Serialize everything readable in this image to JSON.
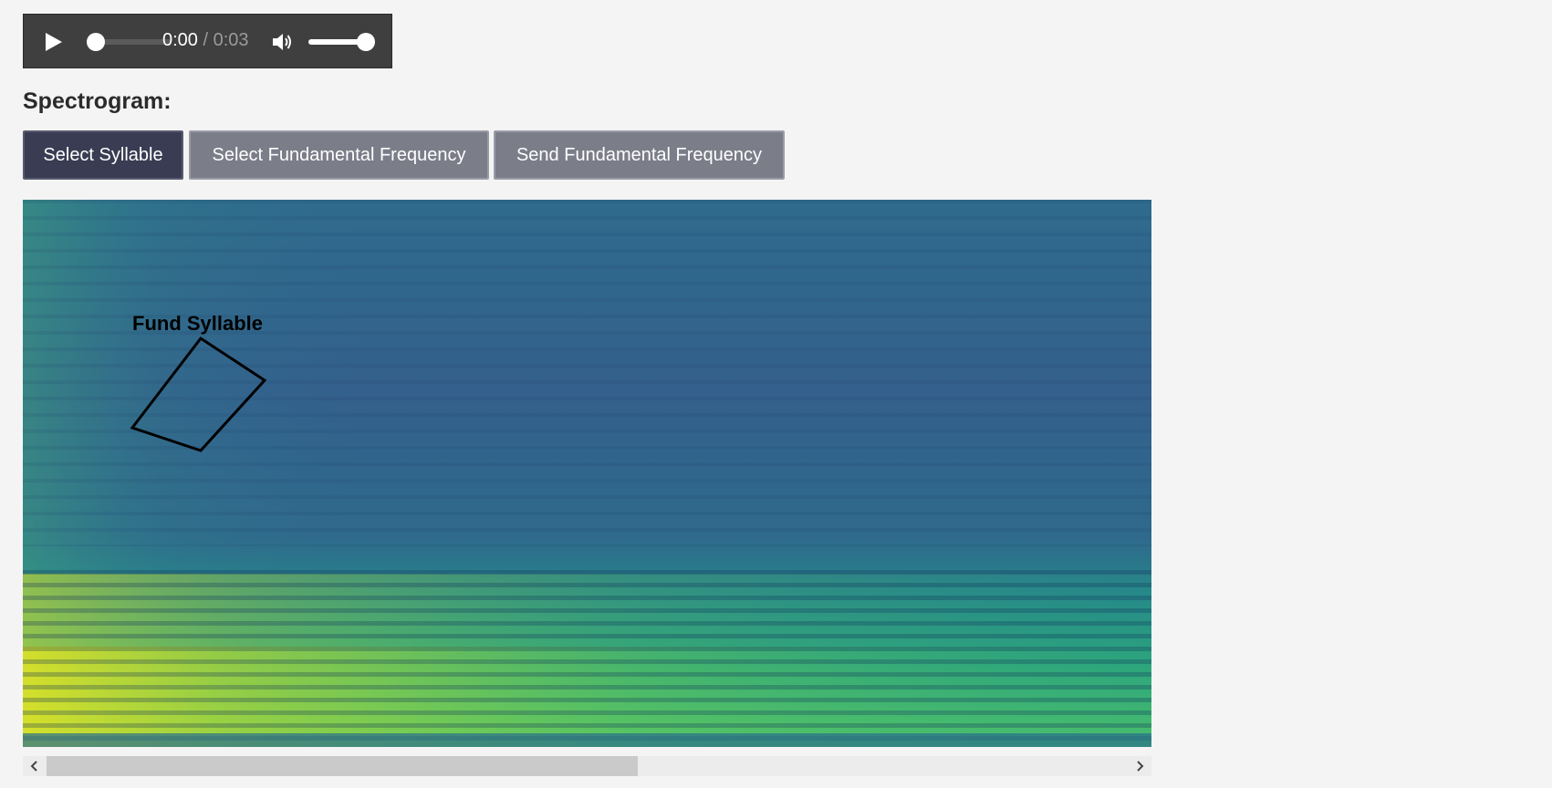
{
  "player": {
    "current_time": "0:00",
    "separator": " / ",
    "duration": "0:03",
    "progress": 0.0,
    "volume": 1.0,
    "icons": {
      "play": "play-icon",
      "volume": "volume-icon"
    }
  },
  "spectrogram": {
    "heading": "Spectrogram:",
    "annotation_label": "Fund Syllable"
  },
  "toolbar": {
    "select_syllable_label": "Select Syllable",
    "select_fundamental_label": "Select Fundamental Frequency",
    "send_fundamental_label": "Send Fundamental Frequency",
    "active_tool": "select_syllable"
  },
  "colors": {
    "active_button": "#393c52",
    "inactive_button": "#7b7d89",
    "spectrogram_low": "#2d6a8e",
    "spectrogram_high": "#e8e620"
  },
  "scrollbar": {
    "left_icon": "chevron-left-icon",
    "right_icon": "chevron-right-icon"
  }
}
